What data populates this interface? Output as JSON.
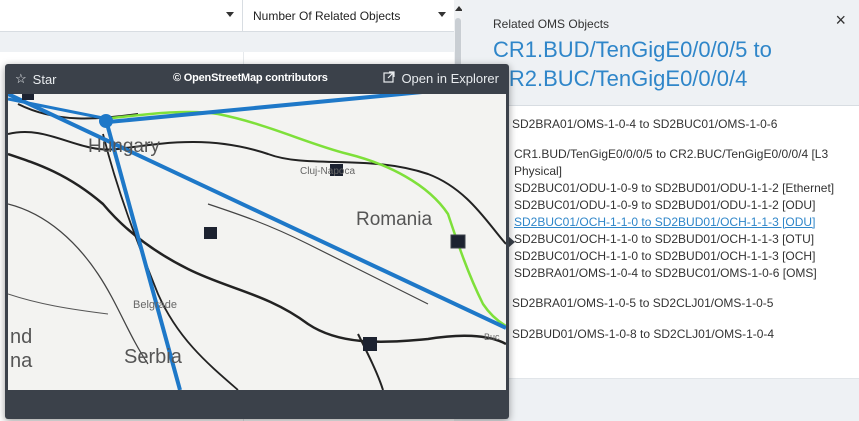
{
  "table": {
    "col2_header": "Number Of Related Objects"
  },
  "map_popover": {
    "star_label": "Star",
    "credit": "© OpenStreetMap contributors",
    "open_label": "Open in Explorer",
    "labels": {
      "hungary": "Hungary",
      "cluj": "Cluj-Napoca",
      "romania": "Romania",
      "belgrade": "Belgrade",
      "serbia": "Serbia",
      "nd": "nd",
      "na": "na",
      "buc": "Buc"
    }
  },
  "panel": {
    "subtitle": "Related OMS Objects",
    "title": "CR1.BUD/TenGigE0/0/0/5 to CR2.BUC/TenGigE0/0/0/4",
    "close": "×",
    "items": [
      {
        "text": "SD2BRA01/OMS-1-0-4 to SD2BUC01/OMS-1-0-6"
      },
      {
        "text": "CR1.BUD/TenGigE0/0/0/5 to CR2.BUC/TenGigE0/0/0/4 [L3 Physical]"
      },
      {
        "text": "SD2BUC01/ODU-1-0-9 to SD2BUD01/ODU-1-1-2 [Ethernet]"
      },
      {
        "text": "SD2BUC01/ODU-1-0-9 to SD2BUD01/ODU-1-1-2 [ODU]"
      },
      {
        "text": "SD2BUC01/OCH-1-1-0 to SD2BUD01/OCH-1-1-3 [ODU]"
      },
      {
        "text": "SD2BUC01/OCH-1-1-0 to SD2BUD01/OCH-1-1-3 [OTU]"
      },
      {
        "text": "SD2BUC01/OCH-1-1-0 to SD2BUD01/OCH-1-1-3 [OCH]"
      },
      {
        "text": "SD2BRA01/OMS-1-0-4 to SD2BUC01/OMS-1-0-6 [OMS]"
      },
      {
        "text": "SD2BRA01/OMS-1-0-5 to SD2CLJ01/OMS-1-0-5"
      },
      {
        "text": "SD2BUD01/OMS-1-0-8 to SD2CLJ01/OMS-1-0-4"
      }
    ]
  },
  "colors": {
    "accent": "#2f86c9",
    "popover_bg": "#3b414a",
    "route_green": "#7ee03a",
    "route_blue": "#1e78c8"
  }
}
